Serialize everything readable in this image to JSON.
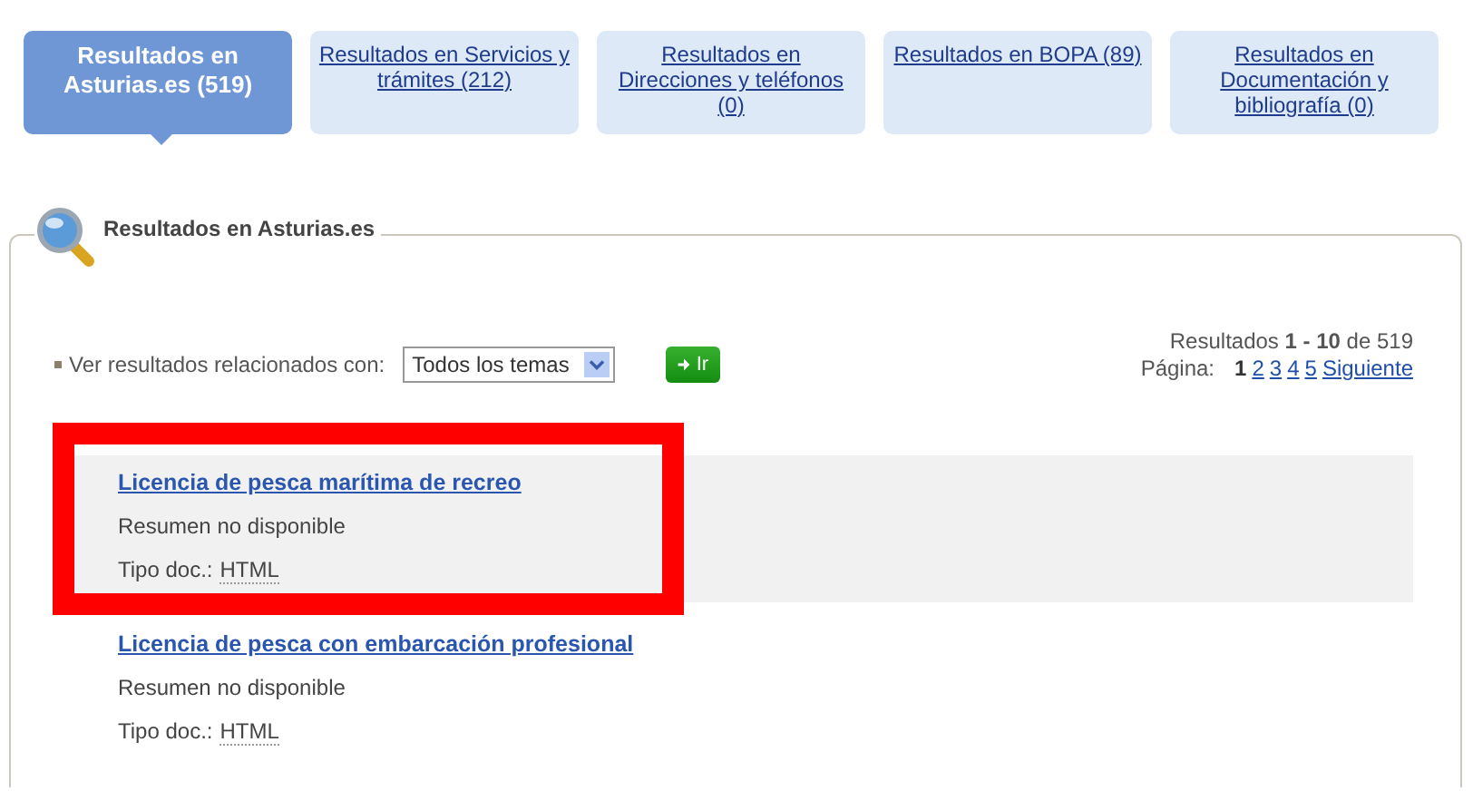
{
  "tabs": [
    {
      "label": "Resultados en Asturias.es (519)",
      "selected": true
    },
    {
      "label": "Resultados en Servicios y trámites (212)",
      "selected": false
    },
    {
      "label": "Resultados en Direcciones y teléfonos (0)",
      "selected": false
    },
    {
      "label": "Resultados en BOPA (89)",
      "selected": false
    },
    {
      "label": "Resultados en Documentación y bibliografía (0)",
      "selected": false
    }
  ],
  "panel": {
    "title": "Resultados en Asturias.es",
    "filter": {
      "label": "Ver resultados relacionados con:",
      "value": "Todos los temas",
      "button": "Ir"
    },
    "summary": {
      "text": "Resultados **1 - 10** de 519",
      "page_label": "Página:",
      "pages": [
        {
          "label": "1",
          "selected": true
        },
        {
          "label": "2",
          "selected": false
        },
        {
          "label": "3",
          "selected": false
        },
        {
          "label": "4",
          "selected": false
        },
        {
          "label": "5",
          "selected": false
        }
      ],
      "next": "Siguiente"
    },
    "results": [
      {
        "title": "Licencia de pesca marítima de recreo",
        "summary": "Resumen no disponible",
        "type_label": "Tipo doc.:",
        "type": "HTML",
        "highlighted": true,
        "annotated": true
      },
      {
        "title": "Licencia de pesca con embarcación profesional",
        "summary": "Resumen no disponible",
        "type_label": "Tipo doc.:",
        "type": "HTML",
        "highlighted": false,
        "annotated": false
      }
    ]
  }
}
